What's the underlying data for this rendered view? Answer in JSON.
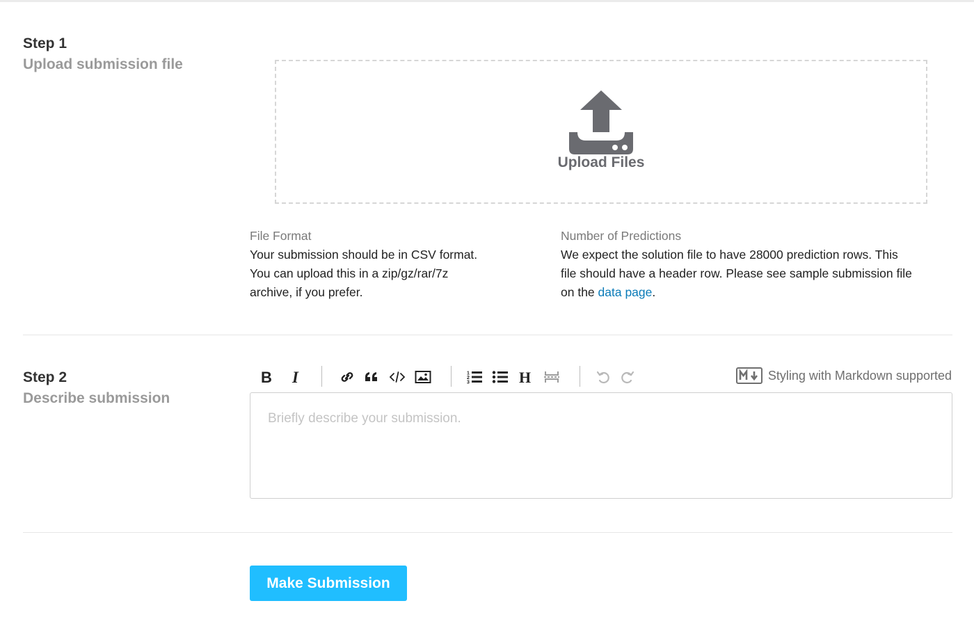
{
  "step1": {
    "title": "Step 1",
    "subtitle": "Upload submission file",
    "upload_label": "Upload Files",
    "upload_icon": "upload-tray-icon",
    "file_format": {
      "title": "File Format",
      "lines": [
        "Your submission should be in CSV format.",
        "You can upload this in a zip/gz/rar/7z",
        "archive, if you prefer."
      ]
    },
    "predictions": {
      "title": "Number of Predictions",
      "lines": [
        "We expect the solution file to have 28000 prediction rows. This",
        "file should have a header row. Please see sample submission file"
      ],
      "last_prefix": "on the ",
      "link_text": "data page",
      "last_suffix": "."
    }
  },
  "step2": {
    "title": "Step 2",
    "subtitle": "Describe submission",
    "toolbar": {
      "items": [
        "bold-icon",
        "italic-icon",
        "link-icon",
        "quote-icon",
        "code-icon",
        "image-icon",
        "ordered-list-icon",
        "unordered-list-icon",
        "heading-icon",
        "horizontal-rule-icon",
        "undo-icon",
        "redo-icon"
      ],
      "markdown_hint": "Styling with Markdown supported"
    },
    "description_placeholder": "Briefly describe your submission."
  },
  "submit": {
    "label": "Make Submission"
  },
  "colors": {
    "accent": "#20beff",
    "link": "#0a7bb8",
    "muted": "#9a9a9a",
    "icon": "#6a6b70"
  }
}
